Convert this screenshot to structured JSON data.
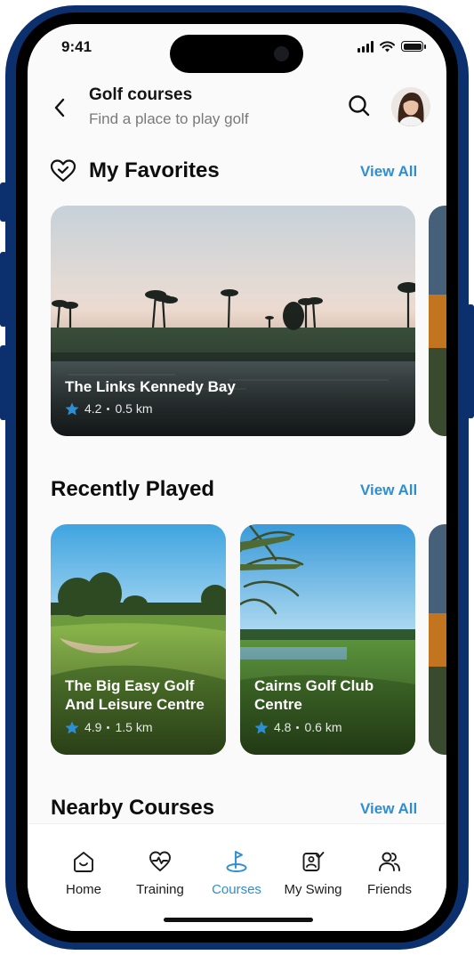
{
  "status": {
    "time": "9:41"
  },
  "header": {
    "title": "Golf courses",
    "subtitle": "Find a place to play golf"
  },
  "favorites": {
    "title": "My Favorites",
    "view_all": "View All",
    "cards": [
      {
        "name": "The Links Kennedy Bay",
        "rating": "4.2",
        "distance": "0.5 km"
      }
    ]
  },
  "recent": {
    "title": "Recently Played",
    "view_all": "View All",
    "cards": [
      {
        "name": "The Big Easy Golf And Leisure Centre",
        "rating": "4.9",
        "distance": "1.5 km"
      },
      {
        "name": "Cairns Golf Club Centre",
        "rating": "4.8",
        "distance": "0.6 km"
      }
    ]
  },
  "nearby": {
    "title": "Nearby Courses",
    "view_all": "View All"
  },
  "tabs": [
    {
      "label": "Home",
      "icon": "home-icon"
    },
    {
      "label": "Training",
      "icon": "heart-pulse-icon"
    },
    {
      "label": "Courses",
      "icon": "golf-flag-icon",
      "active": true
    },
    {
      "label": "My Swing",
      "icon": "swing-check-icon"
    },
    {
      "label": "Friends",
      "icon": "users-icon"
    }
  ],
  "colors": {
    "accent": "#2c8fd6",
    "frame": "#0c2f6e",
    "star": "#2c8fd6"
  }
}
